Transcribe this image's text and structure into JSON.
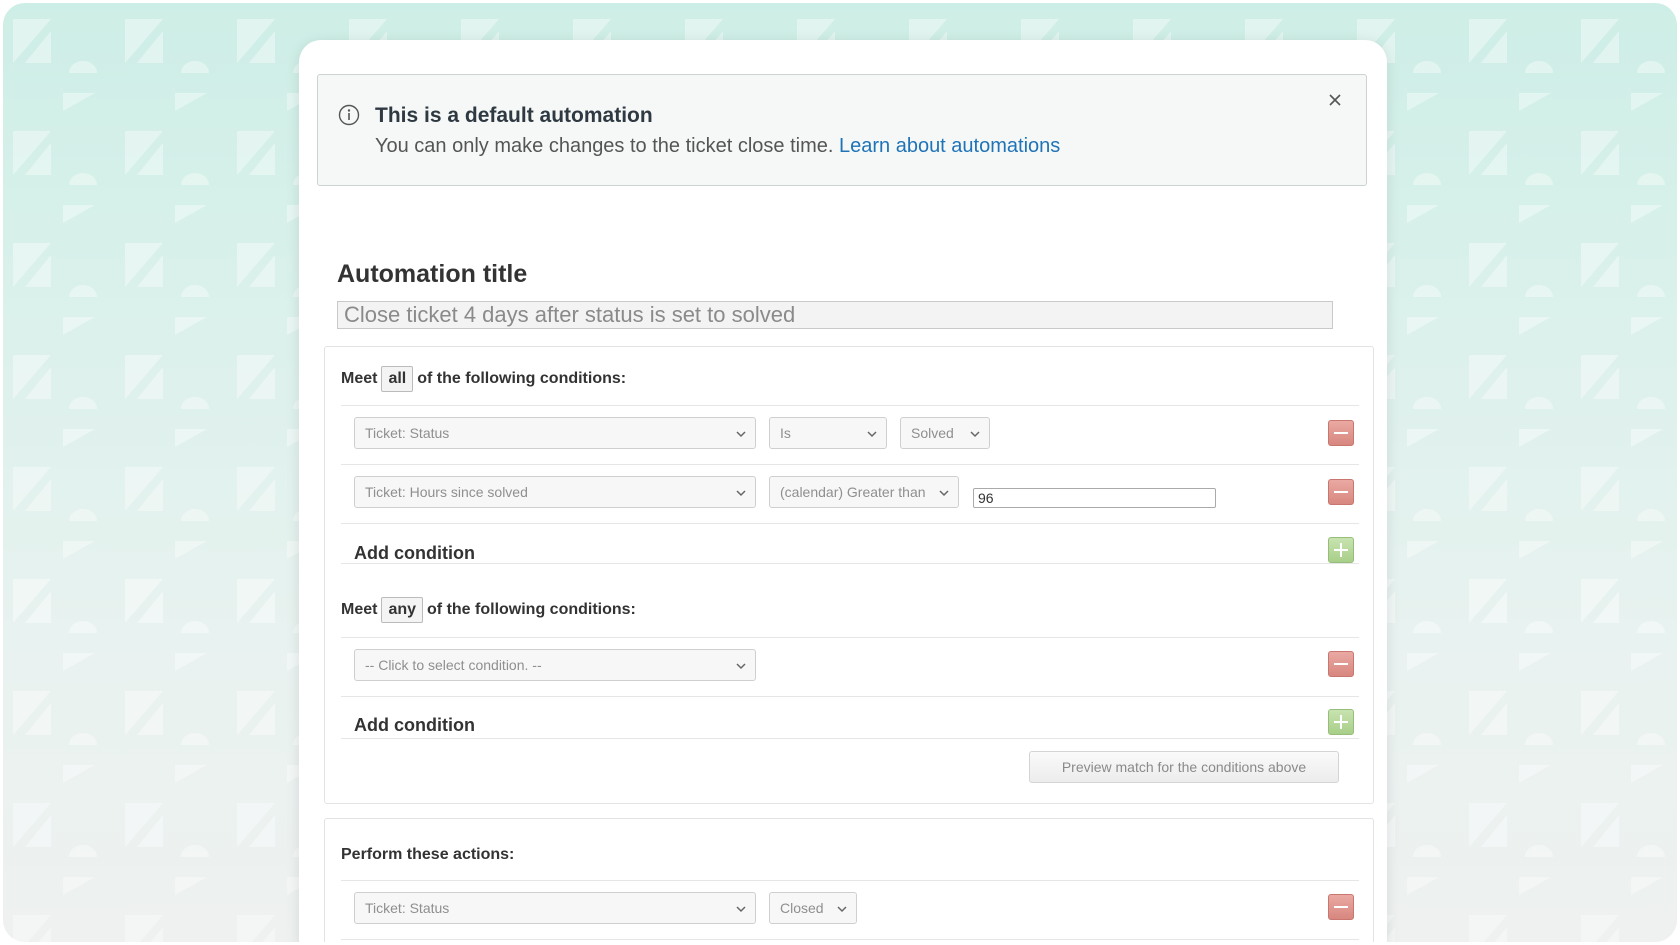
{
  "alert": {
    "title": "This is a default automation",
    "body": "You can only make changes to the ticket close time.",
    "link": "Learn about automations"
  },
  "automation": {
    "heading": "Automation title",
    "title_value": "Close ticket 4 days after status is set to solved"
  },
  "all_conditions": {
    "prefix": "Meet",
    "quantifier": "all",
    "suffix": "of the following conditions:",
    "rows": [
      {
        "field": "Ticket: Status",
        "operator": "Is",
        "value": "Solved"
      },
      {
        "field": "Ticket: Hours since solved",
        "operator": "(calendar) Greater than",
        "value": "96"
      }
    ],
    "add_label": "Add condition"
  },
  "any_conditions": {
    "prefix": "Meet",
    "quantifier": "any",
    "suffix": "of the following conditions:",
    "rows": [
      {
        "field": "-- Click to select condition. --"
      }
    ],
    "add_label": "Add condition",
    "preview_label": "Preview match for the conditions above"
  },
  "actions": {
    "heading": "Perform these actions:",
    "rows": [
      {
        "field": "Ticket: Status",
        "value": "Closed"
      }
    ]
  },
  "colors": {
    "link": "#1f73b7",
    "remove_button": "#d7877f",
    "add_button": "#a8cf89"
  }
}
